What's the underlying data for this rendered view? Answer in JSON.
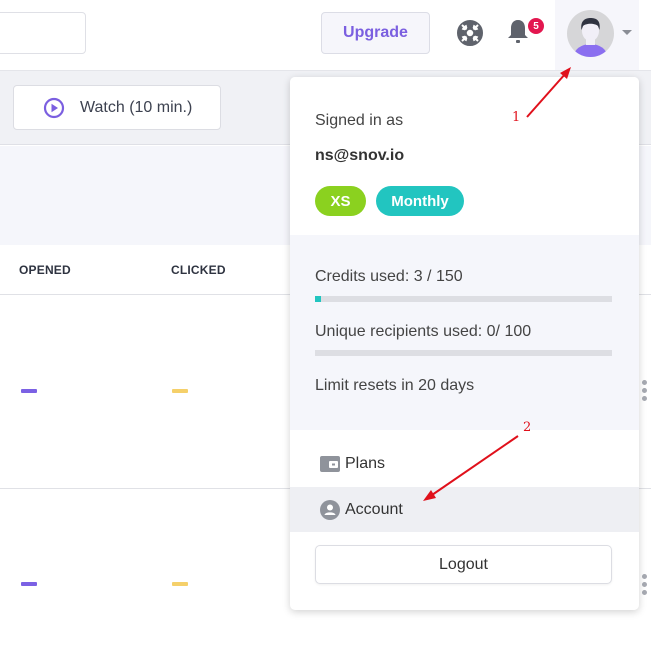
{
  "header": {
    "upgrade_label": "Upgrade",
    "notifications_count": "5",
    "help_icon": "lifebuoy-icon",
    "bell_icon": "bell-icon",
    "avatar_icon": "user-avatar-icon"
  },
  "toolbar": {
    "watch_label": "Watch (10 min.)",
    "watch_icon": "play-circle-icon"
  },
  "table": {
    "columns": [
      "OPENED",
      "CLICKED"
    ],
    "rows": [
      {
        "opened": "–",
        "clicked": "–"
      },
      {
        "opened": "–",
        "clicked": "–"
      }
    ]
  },
  "colors": {
    "accent_purple": "#7b5fe0",
    "opened_dash": "#7b61e4",
    "clicked_dash": "#f5d06a",
    "badge_green": "#8bd11f",
    "badge_teal": "#22c5c0",
    "badge_red": "#e3174f",
    "annotation_red": "#e0101b"
  },
  "account_menu": {
    "signed_in_label": "Signed in as",
    "email": "ns@snov.io",
    "plan_badge": "XS",
    "billing_badge": "Monthly",
    "credits_label": "Credits used: 3 / 150",
    "credits_used": 3,
    "credits_total": 150,
    "recipients_label": "Unique recipients used: 0/ 100",
    "recipients_used": 0,
    "recipients_total": 100,
    "reset_label": "Limit resets in 20 days",
    "items": [
      {
        "label": "Plans",
        "icon": "wallet-icon"
      },
      {
        "label": "Account",
        "icon": "account-circle-icon"
      }
    ],
    "logout_label": "Logout"
  },
  "annotations": [
    {
      "number": "1",
      "target": "profile-avatar"
    },
    {
      "number": "2",
      "target": "account-menu-item"
    }
  ]
}
